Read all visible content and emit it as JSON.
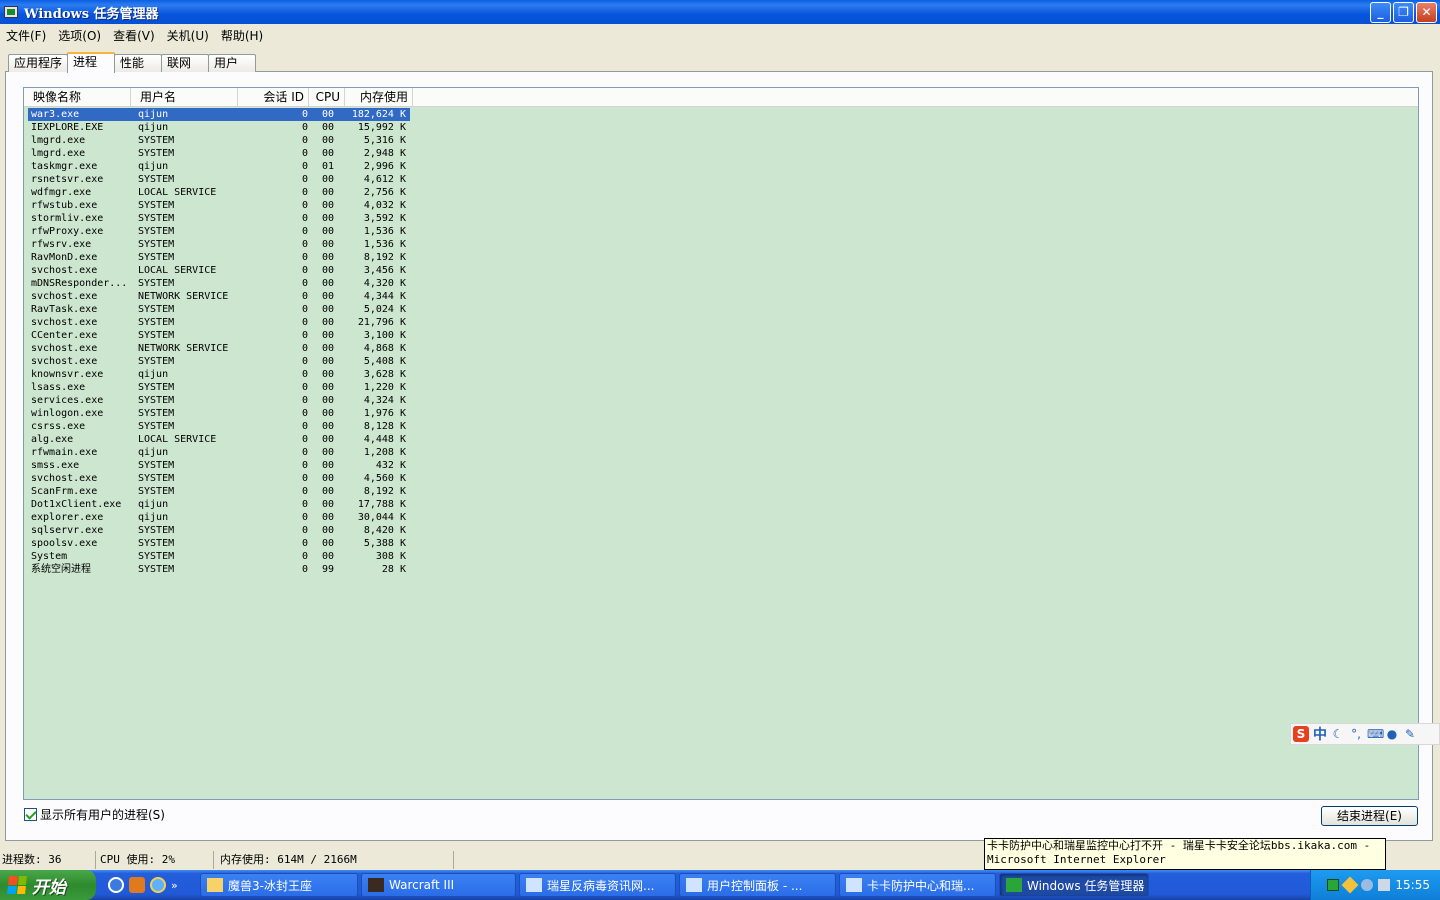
{
  "window": {
    "title": "Windows 任务管理器",
    "minimize": "_",
    "restore": "❐",
    "close": "✕"
  },
  "menu": [
    "文件(F)",
    "选项(O)",
    "查看(V)",
    "关机(U)",
    "帮助(H)"
  ],
  "tabs": [
    "应用程序",
    "进程",
    "性能",
    "联网",
    "用户"
  ],
  "active_tab": "进程",
  "columns": {
    "name": "映像名称",
    "user": "用户名",
    "session": "会话 ID",
    "cpu": "CPU",
    "mem": "内存使用"
  },
  "processes": [
    {
      "name": "war3.exe",
      "user": "qijun",
      "session": "0",
      "cpu": "00",
      "mem": "182,624 K",
      "selected": true
    },
    {
      "name": "IEXPLORE.EXE",
      "user": "qijun",
      "session": "0",
      "cpu": "00",
      "mem": "15,992 K"
    },
    {
      "name": "lmgrd.exe",
      "user": "SYSTEM",
      "session": "0",
      "cpu": "00",
      "mem": "5,316 K"
    },
    {
      "name": "lmgrd.exe",
      "user": "SYSTEM",
      "session": "0",
      "cpu": "00",
      "mem": "2,948 K"
    },
    {
      "name": "taskmgr.exe",
      "user": "qijun",
      "session": "0",
      "cpu": "01",
      "mem": "2,996 K"
    },
    {
      "name": "rsnetsvr.exe",
      "user": "SYSTEM",
      "session": "0",
      "cpu": "00",
      "mem": "4,612 K"
    },
    {
      "name": "wdfmgr.exe",
      "user": "LOCAL SERVICE",
      "session": "0",
      "cpu": "00",
      "mem": "2,756 K"
    },
    {
      "name": "rfwstub.exe",
      "user": "SYSTEM",
      "session": "0",
      "cpu": "00",
      "mem": "4,032 K"
    },
    {
      "name": "stormliv.exe",
      "user": "SYSTEM",
      "session": "0",
      "cpu": "00",
      "mem": "3,592 K"
    },
    {
      "name": "rfwProxy.exe",
      "user": "SYSTEM",
      "session": "0",
      "cpu": "00",
      "mem": "1,536 K"
    },
    {
      "name": "rfwsrv.exe",
      "user": "SYSTEM",
      "session": "0",
      "cpu": "00",
      "mem": "1,536 K"
    },
    {
      "name": "RavMonD.exe",
      "user": "SYSTEM",
      "session": "0",
      "cpu": "00",
      "mem": "8,192 K"
    },
    {
      "name": "svchost.exe",
      "user": "LOCAL SERVICE",
      "session": "0",
      "cpu": "00",
      "mem": "3,456 K"
    },
    {
      "name": "mDNSResponder...",
      "user": "SYSTEM",
      "session": "0",
      "cpu": "00",
      "mem": "4,320 K"
    },
    {
      "name": "svchost.exe",
      "user": "NETWORK SERVICE",
      "session": "0",
      "cpu": "00",
      "mem": "4,344 K"
    },
    {
      "name": "RavTask.exe",
      "user": "SYSTEM",
      "session": "0",
      "cpu": "00",
      "mem": "5,024 K"
    },
    {
      "name": "svchost.exe",
      "user": "SYSTEM",
      "session": "0",
      "cpu": "00",
      "mem": "21,796 K"
    },
    {
      "name": "CCenter.exe",
      "user": "SYSTEM",
      "session": "0",
      "cpu": "00",
      "mem": "3,100 K"
    },
    {
      "name": "svchost.exe",
      "user": "NETWORK SERVICE",
      "session": "0",
      "cpu": "00",
      "mem": "4,868 K"
    },
    {
      "name": "svchost.exe",
      "user": "SYSTEM",
      "session": "0",
      "cpu": "00",
      "mem": "5,408 K"
    },
    {
      "name": "knownsvr.exe",
      "user": "qijun",
      "session": "0",
      "cpu": "00",
      "mem": "3,628 K"
    },
    {
      "name": "lsass.exe",
      "user": "SYSTEM",
      "session": "0",
      "cpu": "00",
      "mem": "1,220 K"
    },
    {
      "name": "services.exe",
      "user": "SYSTEM",
      "session": "0",
      "cpu": "00",
      "mem": "4,324 K"
    },
    {
      "name": "winlogon.exe",
      "user": "SYSTEM",
      "session": "0",
      "cpu": "00",
      "mem": "1,976 K"
    },
    {
      "name": "csrss.exe",
      "user": "SYSTEM",
      "session": "0",
      "cpu": "00",
      "mem": "8,128 K"
    },
    {
      "name": "alg.exe",
      "user": "LOCAL SERVICE",
      "session": "0",
      "cpu": "00",
      "mem": "4,448 K"
    },
    {
      "name": "rfwmain.exe",
      "user": "qijun",
      "session": "0",
      "cpu": "00",
      "mem": "1,208 K"
    },
    {
      "name": "smss.exe",
      "user": "SYSTEM",
      "session": "0",
      "cpu": "00",
      "mem": "432 K"
    },
    {
      "name": "svchost.exe",
      "user": "SYSTEM",
      "session": "0",
      "cpu": "00",
      "mem": "4,560 K"
    },
    {
      "name": "ScanFrm.exe",
      "user": "SYSTEM",
      "session": "0",
      "cpu": "00",
      "mem": "8,192 K"
    },
    {
      "name": "Dot1xClient.exe",
      "user": "qijun",
      "session": "0",
      "cpu": "00",
      "mem": "17,788 K"
    },
    {
      "name": "explorer.exe",
      "user": "qijun",
      "session": "0",
      "cpu": "00",
      "mem": "30,044 K"
    },
    {
      "name": "sqlservr.exe",
      "user": "SYSTEM",
      "session": "0",
      "cpu": "00",
      "mem": "8,420 K"
    },
    {
      "name": "spoolsv.exe",
      "user": "SYSTEM",
      "session": "0",
      "cpu": "00",
      "mem": "5,388 K"
    },
    {
      "name": "System",
      "user": "SYSTEM",
      "session": "0",
      "cpu": "00",
      "mem": "308 K"
    },
    {
      "name": "系统空闲进程",
      "user": "SYSTEM",
      "session": "0",
      "cpu": "99",
      "mem": "28 K"
    }
  ],
  "show_all_label": "显示所有用户的进程(S)",
  "end_process_label": "结束进程(E)",
  "status": {
    "processes": "进程数: 36",
    "cpu": "CPU 使用: 2%",
    "memory": "内存使用: 614M / 2166M"
  },
  "tooltip": {
    "line1": "卡卡防护中心和瑞星监控中心打不开 - 瑞星卡卡安全论坛bbs.ikaka.com -",
    "line2": "Microsoft Internet Explorer"
  },
  "ime": {
    "mode": "中"
  },
  "taskbar": {
    "start_label": "开始",
    "quick_launch_more": "»",
    "buttons": [
      {
        "label": "魔兽3-冰封王座",
        "icon": "folder-icon",
        "color": "#f5d36a",
        "width": 158
      },
      {
        "label": "Warcraft III",
        "icon": "warcraft-icon",
        "color": "#3a2a20",
        "width": 155
      },
      {
        "label": "瑞星反病毒资讯网...",
        "icon": "ie-page-icon",
        "color": "#d0e4ff",
        "width": 157
      },
      {
        "label": "用户控制面板 - ...",
        "icon": "ie-page-icon",
        "color": "#d0e4ff",
        "width": 157
      },
      {
        "label": "卡卡防护中心和瑞...",
        "icon": "ie-page-icon",
        "color": "#d0e4ff",
        "width": 157
      },
      {
        "label": "Windows 任务管理器",
        "icon": "taskmgr-icon",
        "color": "#2aa53a",
        "width": 150,
        "active": true
      }
    ],
    "clock": "15:55"
  }
}
